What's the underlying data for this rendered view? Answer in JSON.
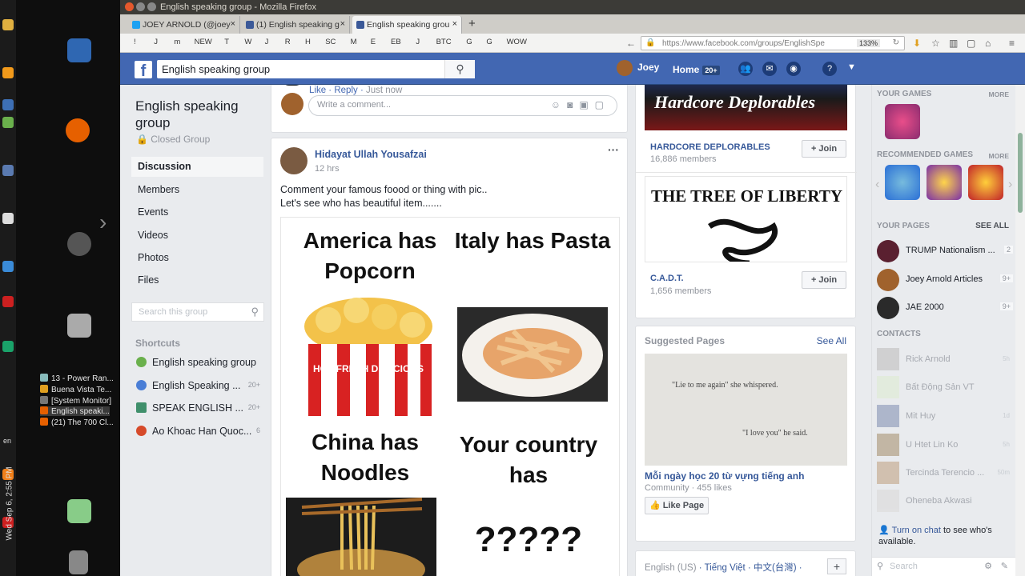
{
  "desktop": {
    "taskbar_items": [
      "13 - Power Ran...",
      "Buena Vista Te...",
      "[System Monitor]",
      "English speaki...",
      "(21) The 700 Cl..."
    ],
    "clock": "Wed Sep 6, 2:55 PM",
    "lang": "en"
  },
  "window": {
    "title": "English speaking group - Mozilla Firefox",
    "tabs": [
      {
        "label": "JOEY ARNOLD (@joey"
      },
      {
        "label": "(1) English speaking g"
      },
      {
        "label": "English speaking grou"
      }
    ],
    "new_tab": "+",
    "bookmarks": [
      "!",
      "J",
      "m",
      "NEW",
      "T",
      "W",
      "J",
      "R",
      "H",
      "SC",
      "M",
      "E",
      "EB",
      "J",
      "BTC",
      "G",
      "G",
      "WOW"
    ],
    "url": "https://www.facebook.com/groups/EnglishSpe",
    "zoom": "133%"
  },
  "fb": {
    "logo": "f",
    "search_value": "English speaking group",
    "user_name": "Joey",
    "home_label": "Home",
    "home_badge": "20+"
  },
  "group": {
    "name": "English speaking group",
    "type": "Closed Group",
    "nav": [
      "Discussion",
      "Members",
      "Events",
      "Videos",
      "Photos",
      "Files"
    ],
    "search_placeholder": "Search this group",
    "shortcuts_title": "Shortcuts",
    "shortcuts": [
      {
        "label": "English speaking group",
        "count": ""
      },
      {
        "label": "English Speaking ...",
        "count": "20+"
      },
      {
        "label": "SPEAK ENGLISH ...",
        "count": "20+"
      },
      {
        "label": "Ao Khoac Han Quoc...",
        "count": "6"
      }
    ]
  },
  "comment": {
    "like": "Like",
    "reply": "Reply",
    "time": "Just now",
    "placeholder": "Write a comment..."
  },
  "post": {
    "author": "Hidayat Ullah Yousafzai",
    "time": "12 hrs",
    "line1": "Comment your famous foood or thing with pic..",
    "line2": "Let's see who has beautiful item.......",
    "img_q1": "America has Popcorn",
    "img_q2": "Italy has Pasta",
    "img_q3": "China has Noodles",
    "img_q4": "Your country has",
    "img_q5": "?????",
    "popcorn_text": "HOT FRESH DELICIOUS"
  },
  "groups_suggest": [
    {
      "banner": "Hardcore Deplorables",
      "name": "HARDCORE DEPLORABLES",
      "members": "16,886 members",
      "join": "Join"
    },
    {
      "banner": "THE TREE OF LIBERTY",
      "name": "C.A.D.T.",
      "members": "1,656 members",
      "join": "Join"
    }
  ],
  "suggested_pages": {
    "title": "Suggested Pages",
    "see_all": "See All",
    "quote1": "\"Lie to me again\" she whispered.",
    "quote2": "\"I love you\" he said.",
    "page_name": "Mỗi ngày học 20 từ vựng tiếng anh",
    "page_meta": "Community · 455 likes",
    "like_btn": "Like Page"
  },
  "languages": {
    "current": "English (US)",
    "others": "Tiếng Việt · 中文(台灣) ·",
    "plus": "+"
  },
  "right": {
    "your_games": "YOUR GAMES",
    "more": "MORE",
    "recommended_games": "RECOMMENDED GAMES",
    "your_pages": "YOUR PAGES",
    "see_all": "SEE ALL",
    "pages": [
      {
        "name": "TRUMP Nationalism ...",
        "count": "2"
      },
      {
        "name": "Joey Arnold Articles",
        "count": "9+"
      },
      {
        "name": "JAE 2000",
        "count": "9+"
      }
    ],
    "contacts_title": "CONTACTS",
    "contacts": [
      {
        "name": "Rick Arnold",
        "time": "5h"
      },
      {
        "name": "Bất Động Sản VT",
        "time": ""
      },
      {
        "name": "Mit Huy",
        "time": "1d"
      },
      {
        "name": "U Htet Lin Ko",
        "time": "5h"
      },
      {
        "name": "Tercinda Terencio ...",
        "time": "50m"
      },
      {
        "name": "Oheneba Akwasi",
        "time": ""
      }
    ],
    "chat_link": "Turn on chat",
    "chat_rest": "to see who's available.",
    "search_placeholder": "Search"
  }
}
